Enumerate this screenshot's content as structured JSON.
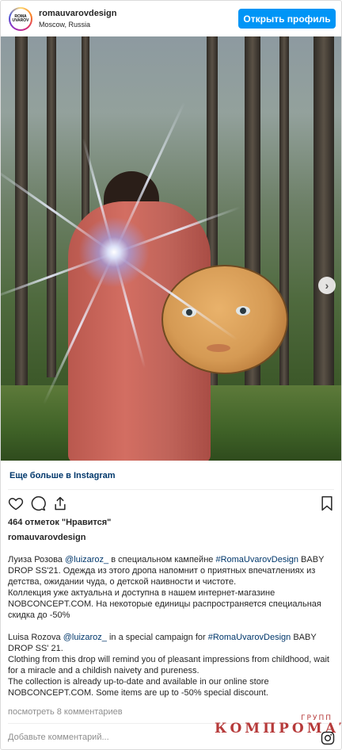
{
  "header": {
    "avatar_text": "ROMA UVAROV",
    "username": "romauvarovdesign",
    "location": "Moscow, Russia",
    "profile_button": "Открыть профиль"
  },
  "photo": {
    "carousel_total": 2,
    "carousel_current": 1,
    "next_arrow": "›"
  },
  "more_link": "Еще больше в Instagram",
  "actions": {
    "icons": [
      "heart-icon",
      "comment-icon",
      "share-icon",
      "bookmark-icon"
    ]
  },
  "likes": "464 отметок \"Нравится\"",
  "caption": {
    "username": "romauvarovdesign",
    "ru": {
      "prefix": "Луиза Розова ",
      "mention": "@luizaroz_",
      "mid": " в специальном кампейне ",
      "hashtag": "#RomaUvarovDesign",
      "text1": " BABY DROP SS'21. Одежда из этого дропа напомнит о приятных впечатлениях из детства, ожидании чуда, о детской наивности и чистоте.",
      "text2": "Коллекция уже актуальна и доступна в нашем интернет-магазине NOBCONCEPT.COM. На некоторые единицы распространяется специальная скидка до -50%"
    },
    "en": {
      "prefix": "Luisa Rozova ",
      "mention": "@luizaroz_",
      "mid": " in a special campaign for ",
      "hashtag": "#RomaUvarovDesign",
      "text1": " BABY DROP SS' 21.",
      "text2": "Clothing from this drop will remind you of pleasant impressions from childhood, wait for a miracle and a childish naivety and pureness.",
      "text3": "The collection is already up-to-date and available in our online store NOBCONCEPT.COM. Some items are up to -50% special discount."
    }
  },
  "comments_link": "посмотреть 8 комментариев",
  "comment_placeholder": "Добавьте комментарий...",
  "watermark": {
    "small": "ГРУПП",
    "big": "КОМПРОМАТ"
  },
  "colors": {
    "accent": "#0095f6",
    "link": "#00376b",
    "muted": "#8e8e8e",
    "watermark": "#b63a3a"
  }
}
